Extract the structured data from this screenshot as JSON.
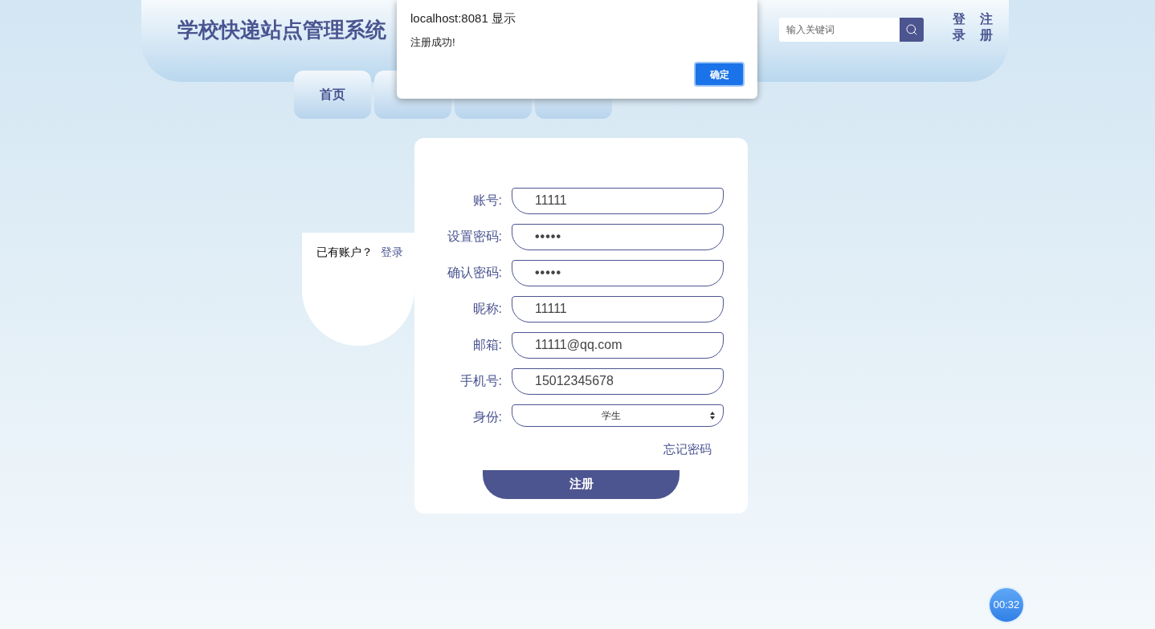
{
  "header": {
    "title": "学校快递站点管理系统",
    "search": {
      "placeholder": "输入关键词"
    },
    "links": [
      {
        "label": "登录"
      },
      {
        "label": "注册"
      }
    ]
  },
  "tabs": [
    {
      "label": "首页",
      "selected": false
    },
    {
      "selected": false
    },
    {
      "selected": false
    },
    {
      "selected": false
    }
  ],
  "side_panel": {
    "text": "已有账户？",
    "link": "登录"
  },
  "form": {
    "fields": [
      {
        "label": "账号:",
        "kind": "text",
        "value": "11111"
      },
      {
        "label": "设置密码:",
        "kind": "password",
        "value": "•••••"
      },
      {
        "label": "确认密码:",
        "kind": "password",
        "value": "•••••"
      },
      {
        "label": "昵称:",
        "kind": "text",
        "value": "11111"
      },
      {
        "label": "邮箱:",
        "kind": "text",
        "value": "11111@qq.com"
      },
      {
        "label": "手机号:",
        "kind": "text",
        "value": "15012345678"
      },
      {
        "label": "身份:",
        "kind": "select",
        "value": "学生"
      }
    ],
    "forgot_link": "忘记密码",
    "submit": "注册"
  },
  "dialog": {
    "title": "localhost:8081 显示",
    "message": "注册成功!",
    "button": "确定"
  },
  "timer": "00:32"
}
